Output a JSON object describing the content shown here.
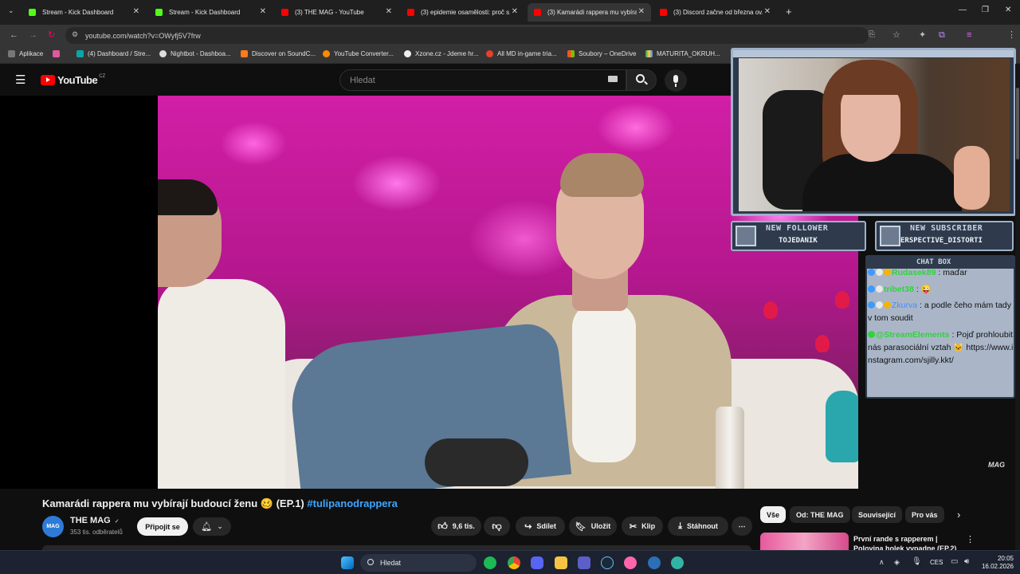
{
  "browser": {
    "tabs": [
      {
        "title": "Stream - Kick Dashboard",
        "favicon": "kick-icon"
      },
      {
        "title": "Stream - Kick Dashboard",
        "favicon": "kick-icon"
      },
      {
        "title": "(3) THE MAG - YouTube",
        "favicon": "youtube-icon"
      },
      {
        "title": "(3) epidemie osamělosti: proč s...",
        "favicon": "youtube-icon"
      },
      {
        "title": "(3) Kamarádi rappera mu vybíra...",
        "favicon": "youtube-icon"
      },
      {
        "title": "(3) Discord začne od března ov...",
        "favicon": "youtube-icon"
      }
    ],
    "url": "youtube.com/watch?v=OWyfj5V7frw",
    "bookmarks": [
      "Aplikace",
      "(4) Dashboard / Stre...",
      "Nightbot - Dashboa...",
      "Discover on SoundC...",
      "YouTube Converter...",
      "Xzone.cz - Jdeme hr...",
      "All MD in-game tria...",
      "Soubory – OneDrive",
      "MATURITA_OKRUH..."
    ]
  },
  "youtube": {
    "logo": "YouTube",
    "region": "CZ",
    "search_placeholder": "Hledat",
    "video_title": "Kamarádi rappera mu vybírají budoucí ženu 🥴 (EP.1)",
    "hashtag": "#tulipanodrappera",
    "watermark": "MAG",
    "channel": {
      "avatar_text": "MAG",
      "name": "THE MAG",
      "verified": "✓",
      "subscribers": "353 tis. odběratelů",
      "join_label": "Připojit se"
    },
    "actions": {
      "likes": "9,6 tis.",
      "share": "Sdílet",
      "save": "Uložit",
      "clip": "Klip",
      "download": "Stáhnout"
    },
    "chips": [
      "Vše",
      "Od: THE MAG",
      "Související",
      "Pro vás"
    ],
    "recommended_title": "První rande s rapperem | Polovina holek vypadne (EP.2)"
  },
  "overlay": {
    "new_follower_label": "NEW FOLLOWER",
    "new_follower_name": "TOJEDANIK",
    "new_subscriber_label": "NEW SUBSCRIBER",
    "new_subscriber_name": "ERSPECTIVE_DISTORTI",
    "chat_title": "CHAT BOX",
    "chat": [
      {
        "user": "Rudasek89",
        "user_color": "#2fd43a",
        "text": " : maďar"
      },
      {
        "user": "tribet38",
        "user_color": "#2fd43a",
        "text": " : 😜"
      },
      {
        "user": "Zkurva",
        "user_color": "#4a8cff",
        "text": " : a podle čeho mám tady v tom soudit"
      },
      {
        "user": "@StreamElements",
        "user_color": "#2fd43a",
        "text": " : Pojď prohloubit nás parasociální vztah 🐱 https://www.instagram.com/sjilly.kkt/"
      }
    ]
  },
  "taskbar": {
    "search_placeholder": "Hledat",
    "language": "CES",
    "time": "20:05",
    "date": "16.02.2026"
  },
  "colors": {
    "accent_blue": "#3ea6ff",
    "youtube_red": "#ff0000",
    "kick_green": "#53fc18"
  }
}
